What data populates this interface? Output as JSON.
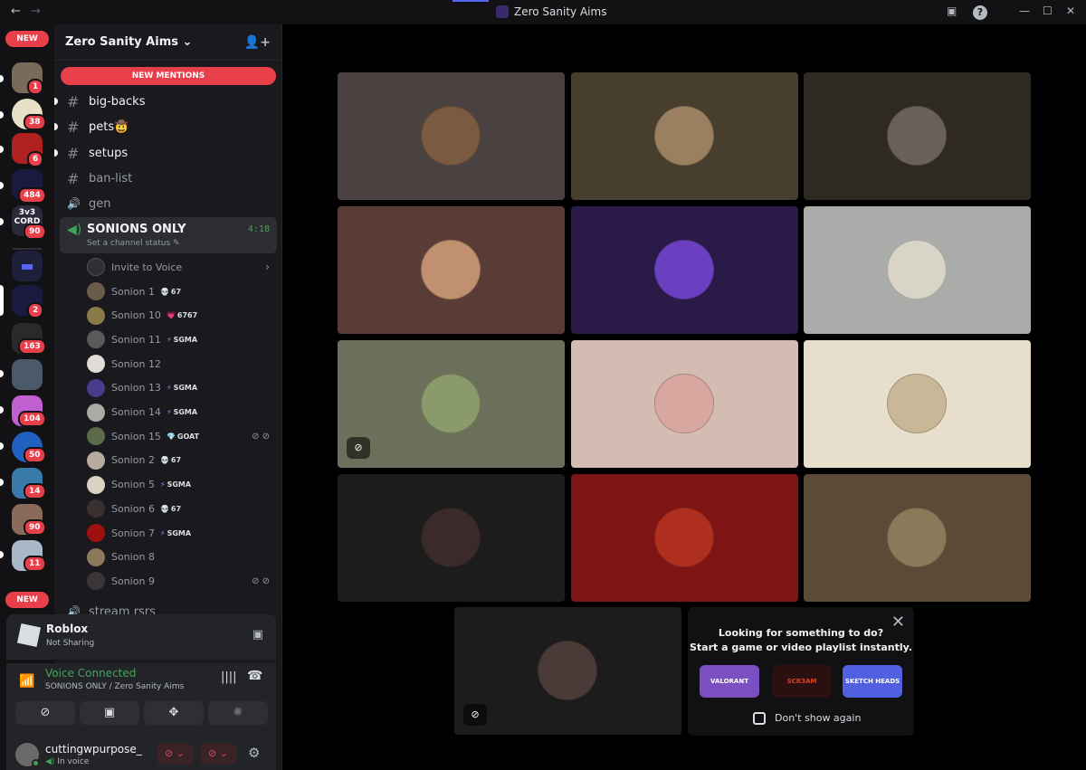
{
  "window": {
    "title": "Zero Sanity Aims",
    "back": "←",
    "forward": "→"
  },
  "rail": {
    "new_top": "NEW",
    "new_bottom": "NEW",
    "badges": [
      "1",
      "38",
      "6",
      "484",
      "90",
      "2",
      "163",
      "104",
      "50",
      "14",
      "90",
      "11"
    ],
    "server_texts": [
      "3v3 CORD"
    ]
  },
  "guild": {
    "name": "Zero Sanity Aims",
    "chevron": "⌄",
    "new_mentions": "NEW MENTIONS"
  },
  "channels": [
    {
      "name": "big-backs",
      "icon": "#"
    },
    {
      "name": "pets🤠",
      "icon": "#"
    },
    {
      "name": "setups",
      "icon": "#"
    },
    {
      "name": "ban-list",
      "icon": "#"
    },
    {
      "name": "gen",
      "icon": "🔊"
    }
  ],
  "voice_channel": {
    "name": "SONIONS ONLY",
    "status": "Set a channel status",
    "time": "4:18"
  },
  "invite": "Invite to Voice",
  "members": [
    {
      "name": "Sonion 1",
      "tag": "67",
      "tag_icon": "💀",
      "color": "#6b5b4a"
    },
    {
      "name": "Sonion 10",
      "tag": "6767",
      "tag_icon": "💗",
      "color": "#8a7a4a"
    },
    {
      "name": "Sonion 11",
      "tag": "SGMA",
      "tag_icon": "⚡",
      "color": "#5a5a5a"
    },
    {
      "name": "Sonion 12",
      "tag": "",
      "tag_icon": "",
      "color": "#e0ddd8"
    },
    {
      "name": "Sonion 13",
      "tag": "SGMA",
      "tag_icon": "⚡",
      "color": "#4a3a8a"
    },
    {
      "name": "Sonion 14",
      "tag": "SGMA",
      "tag_icon": "⚡",
      "color": "#a9aba5"
    },
    {
      "name": "Sonion 15",
      "tag": "GOAT",
      "tag_icon": "💎",
      "color": "#5a6a4a"
    },
    {
      "name": "Sonion 2",
      "tag": "67",
      "tag_icon": "💀",
      "color": "#b8aba0"
    },
    {
      "name": "Sonion 5",
      "tag": "SGMA",
      "tag_icon": "⚡",
      "color": "#ddd2c2"
    },
    {
      "name": "Sonion 6",
      "tag": "67",
      "tag_icon": "💀",
      "color": "#3a3030"
    },
    {
      "name": "Sonion 7",
      "tag": "SGMA",
      "tag_icon": "⚡",
      "color": "#a01010"
    },
    {
      "name": "Sonion 8",
      "tag": "",
      "tag_icon": "",
      "color": "#8a7a5a"
    },
    {
      "name": "Sonion 9",
      "tag": "",
      "tag_icon": "",
      "color": "#3a3538"
    }
  ],
  "next_channel": "stream rsrs",
  "activity": {
    "name": "Roblox",
    "status": "Not Sharing"
  },
  "voice": {
    "status": "Voice Connected",
    "location": "SONIONS ONLY / Zero Sanity Aims"
  },
  "user": {
    "name": "cuttingwpurpose_",
    "status": "In voice"
  },
  "tiles": [
    {
      "bg": "#4a4240",
      "av": "#7a5a40"
    },
    {
      "bg": "#473e2e",
      "av": "#9a8060"
    },
    {
      "bg": "#2e2a22",
      "av": "#6a6058"
    },
    {
      "bg": "#5a3c36",
      "av": "#c09070"
    },
    {
      "bg": "#2a1a48",
      "av": "#6a40c0"
    },
    {
      "bg": "#a9aca9",
      "av": "#d8d4c8"
    },
    {
      "bg": "#6c705a",
      "av": "#8a9a6a"
    },
    {
      "bg": "#d5bcb2",
      "av": "#d8a8a0"
    },
    {
      "bg": "#e7dfcb",
      "av": "#c8b898"
    },
    {
      "bg": "#1c1c1d",
      "av": "#3a2a2a"
    },
    {
      "bg": "#7e1414",
      "av": "#b03020"
    },
    {
      "bg": "#5a4a36",
      "av": "#8a7a5a"
    }
  ],
  "self_tile": {
    "bg": "#1c1c1d",
    "av": "#4a3a38"
  },
  "promo": {
    "line1": "Looking for something to do?",
    "line2": "Start a game or video playlist instantly.",
    "close": "✕",
    "games": [
      "VALORANT",
      "SCR3AM",
      "SKETCH HEADS"
    ],
    "dont_show": "Don't show again"
  }
}
